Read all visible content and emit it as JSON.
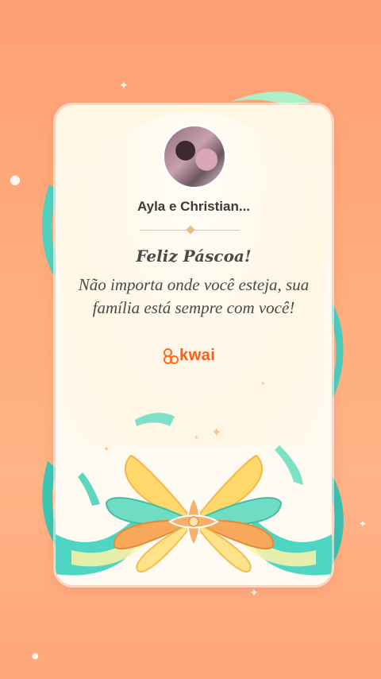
{
  "card": {
    "username": "Ayla e Christian...",
    "title": "Feliz Páscoa!",
    "message": "Não importa onde você esteja, sua família está sempre com você!",
    "brand": "kwai"
  },
  "colors": {
    "background": "#ffa67c",
    "card": "#fff8ea",
    "brand": "#ff5a19",
    "ribbon_teal": "#5fdcc0",
    "ribbon_yellow": "#ffd86a",
    "petal_orange": "#f7a85a"
  },
  "icons": [
    "sparkle-icon",
    "kwai-logo-icon",
    "butterfly-ornament"
  ]
}
